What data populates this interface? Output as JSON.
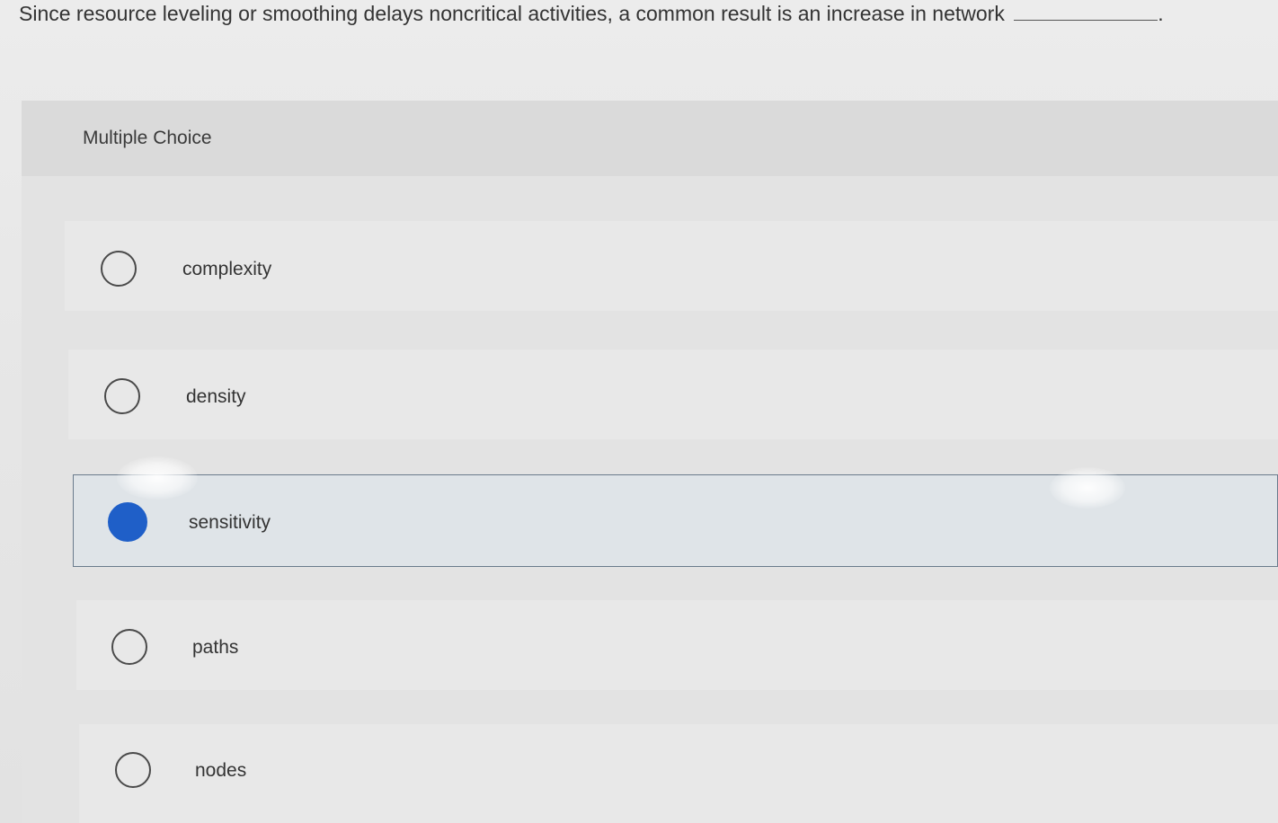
{
  "question": {
    "text": "Since resource leveling or smoothing delays noncritical activities, a common result is an increase in network",
    "end_punct": "."
  },
  "multiple_choice": {
    "label": "Multiple Choice",
    "options": [
      {
        "label": "complexity",
        "selected": false
      },
      {
        "label": "density",
        "selected": false
      },
      {
        "label": "sensitivity",
        "selected": true
      },
      {
        "label": "paths",
        "selected": false
      },
      {
        "label": "nodes",
        "selected": false
      }
    ]
  },
  "colors": {
    "selected_radio": "#1f5fc8",
    "selected_row_bg": "#dfe4e8",
    "selected_row_border": "#6a7b8c"
  }
}
